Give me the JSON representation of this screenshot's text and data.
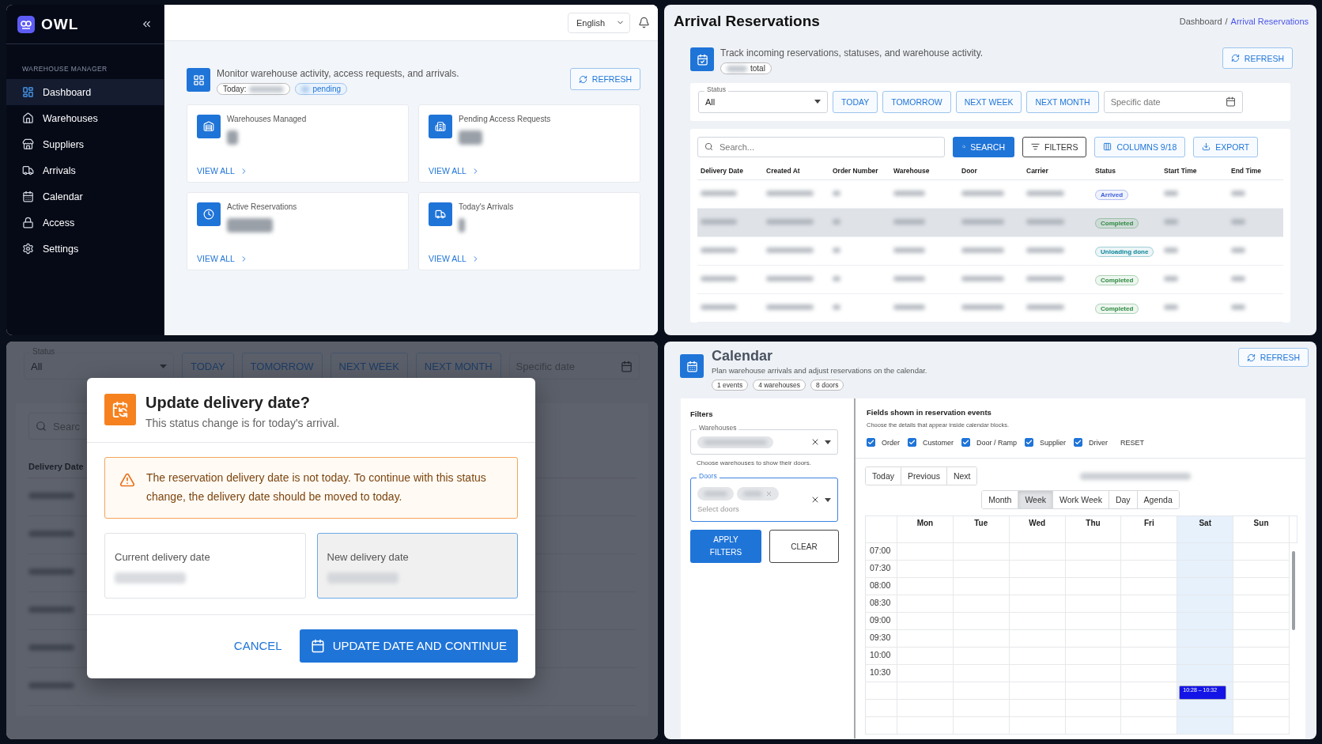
{
  "dashboard": {
    "brand": "OWL",
    "sidebar": {
      "section": "WAREHOUSE MANAGER",
      "items": [
        {
          "label": "Dashboard",
          "selected": true
        },
        {
          "label": "Warehouses",
          "selected": false
        },
        {
          "label": "Suppliers",
          "selected": false
        },
        {
          "label": "Arrivals",
          "selected": false
        },
        {
          "label": "Calendar",
          "selected": false
        },
        {
          "label": "Access",
          "selected": false
        },
        {
          "label": "Settings",
          "selected": false
        }
      ]
    },
    "language": "English",
    "intro": "Monitor warehouse activity, access requests, and arrivals.",
    "today_label": "Today:",
    "pending_label": "pending",
    "refresh": "REFRESH",
    "stats": [
      {
        "title": "Warehouses Managed",
        "link": "VIEW ALL"
      },
      {
        "title": "Pending Access Requests",
        "link": "VIEW ALL"
      },
      {
        "title": "Active Reservations",
        "link": "VIEW ALL"
      },
      {
        "title": "Today's Arrivals",
        "link": "VIEW ALL"
      }
    ]
  },
  "reservations": {
    "title": "Arrival Reservations",
    "breadcrumb": [
      {
        "label": "Dashboard",
        "selected": false
      },
      {
        "label": "Arrival Reservations",
        "selected": true
      }
    ],
    "separator": "/",
    "intro": "Track incoming reservations, statuses, and warehouse activity.",
    "total_label": "total",
    "refresh": "REFRESH",
    "status_label": "Status",
    "status_value": "All",
    "quick_filters": [
      "TODAY",
      "TOMORROW",
      "NEXT WEEK",
      "NEXT MONTH"
    ],
    "date_placeholder": "Specific date",
    "search_placeholder": "Search...",
    "actions": [
      {
        "label": "SEARCH",
        "kind": "search"
      },
      {
        "label": "FILTERS",
        "kind": "filters"
      },
      {
        "label": "COLUMNS 9/18",
        "kind": "columns"
      },
      {
        "label": "EXPORT",
        "kind": "export"
      }
    ],
    "columns": [
      "Delivery Date",
      "Created At",
      "Order Number",
      "Warehouse",
      "Door",
      "Carrier",
      "Status",
      "Start Time",
      "End Time"
    ],
    "rows": [
      {
        "status": "Arrived",
        "color": "#3b5bdb",
        "selected": false
      },
      {
        "status": "Completed",
        "color": "#2b8a3e",
        "selected": true
      },
      {
        "status": "Unloading done",
        "color": "#0c8599",
        "selected": false
      },
      {
        "status": "Completed",
        "color": "#2b8a3e",
        "selected": false
      },
      {
        "status": "Completed",
        "color": "#2b8a3e",
        "selected": false
      }
    ]
  },
  "update_modal": {
    "background": {
      "status_label": "Status",
      "status_value": "All",
      "quick_filters": [
        "TODAY",
        "TOMORROW",
        "NEXT WEEK",
        "NEXT MONTH"
      ],
      "date_placeholder": "Specific date",
      "search_placeholder": "Searc",
      "column": "Delivery Date"
    },
    "dialog": {
      "title": "Update delivery date?",
      "subtitle": "This status change is for today's arrival.",
      "warning": "The reservation delivery date is not today. To continue with this status change, the delivery date should be moved to today.",
      "current_label": "Current delivery date",
      "new_label": "New delivery date",
      "cancel": "CANCEL",
      "confirm": "UPDATE DATE AND CONTINUE"
    }
  },
  "calendar": {
    "title": "Calendar",
    "subtitle": "Plan warehouse arrivals and adjust reservations on the calendar.",
    "chips": [
      "1 events",
      "4 warehouses",
      "8 doors"
    ],
    "refresh": "REFRESH",
    "filters": {
      "title": "Filters",
      "warehouses_label": "Warehouses",
      "warehouses_help": "Choose warehouses to show their doors.",
      "doors_label": "Doors",
      "doors_placeholder": "Select doors",
      "apply": "APPLY FILTERS",
      "clear": "CLEAR"
    },
    "fields": {
      "title": "Fields shown in reservation events",
      "help": "Choose the details that appear inside calendar blocks.",
      "options": [
        {
          "label": "Order",
          "checked": true
        },
        {
          "label": "Customer",
          "checked": true
        },
        {
          "label": "Door / Ramp",
          "checked": true
        },
        {
          "label": "Supplier",
          "checked": true
        },
        {
          "label": "Driver",
          "checked": true
        }
      ],
      "reset": "RESET"
    },
    "nav": [
      "Today",
      "Previous",
      "Next"
    ],
    "views": [
      {
        "label": "Month",
        "selected": false
      },
      {
        "label": "Week",
        "selected": true
      },
      {
        "label": "Work Week",
        "selected": false
      },
      {
        "label": "Day",
        "selected": false
      },
      {
        "label": "Agenda",
        "selected": false
      }
    ],
    "days": [
      {
        "label": "Mon",
        "selected": false
      },
      {
        "label": "Tue",
        "selected": false
      },
      {
        "label": "Wed",
        "selected": false
      },
      {
        "label": "Thu",
        "selected": false
      },
      {
        "label": "Fri",
        "selected": false
      },
      {
        "label": "Sat",
        "selected": true
      },
      {
        "label": "Sun",
        "selected": false
      }
    ],
    "times": [
      "07:00",
      "07:30",
      "08:00",
      "08:30",
      "09:00",
      "09:30",
      "10:00",
      "10:30"
    ],
    "event": {
      "time": "10:28 – 10:32"
    }
  }
}
